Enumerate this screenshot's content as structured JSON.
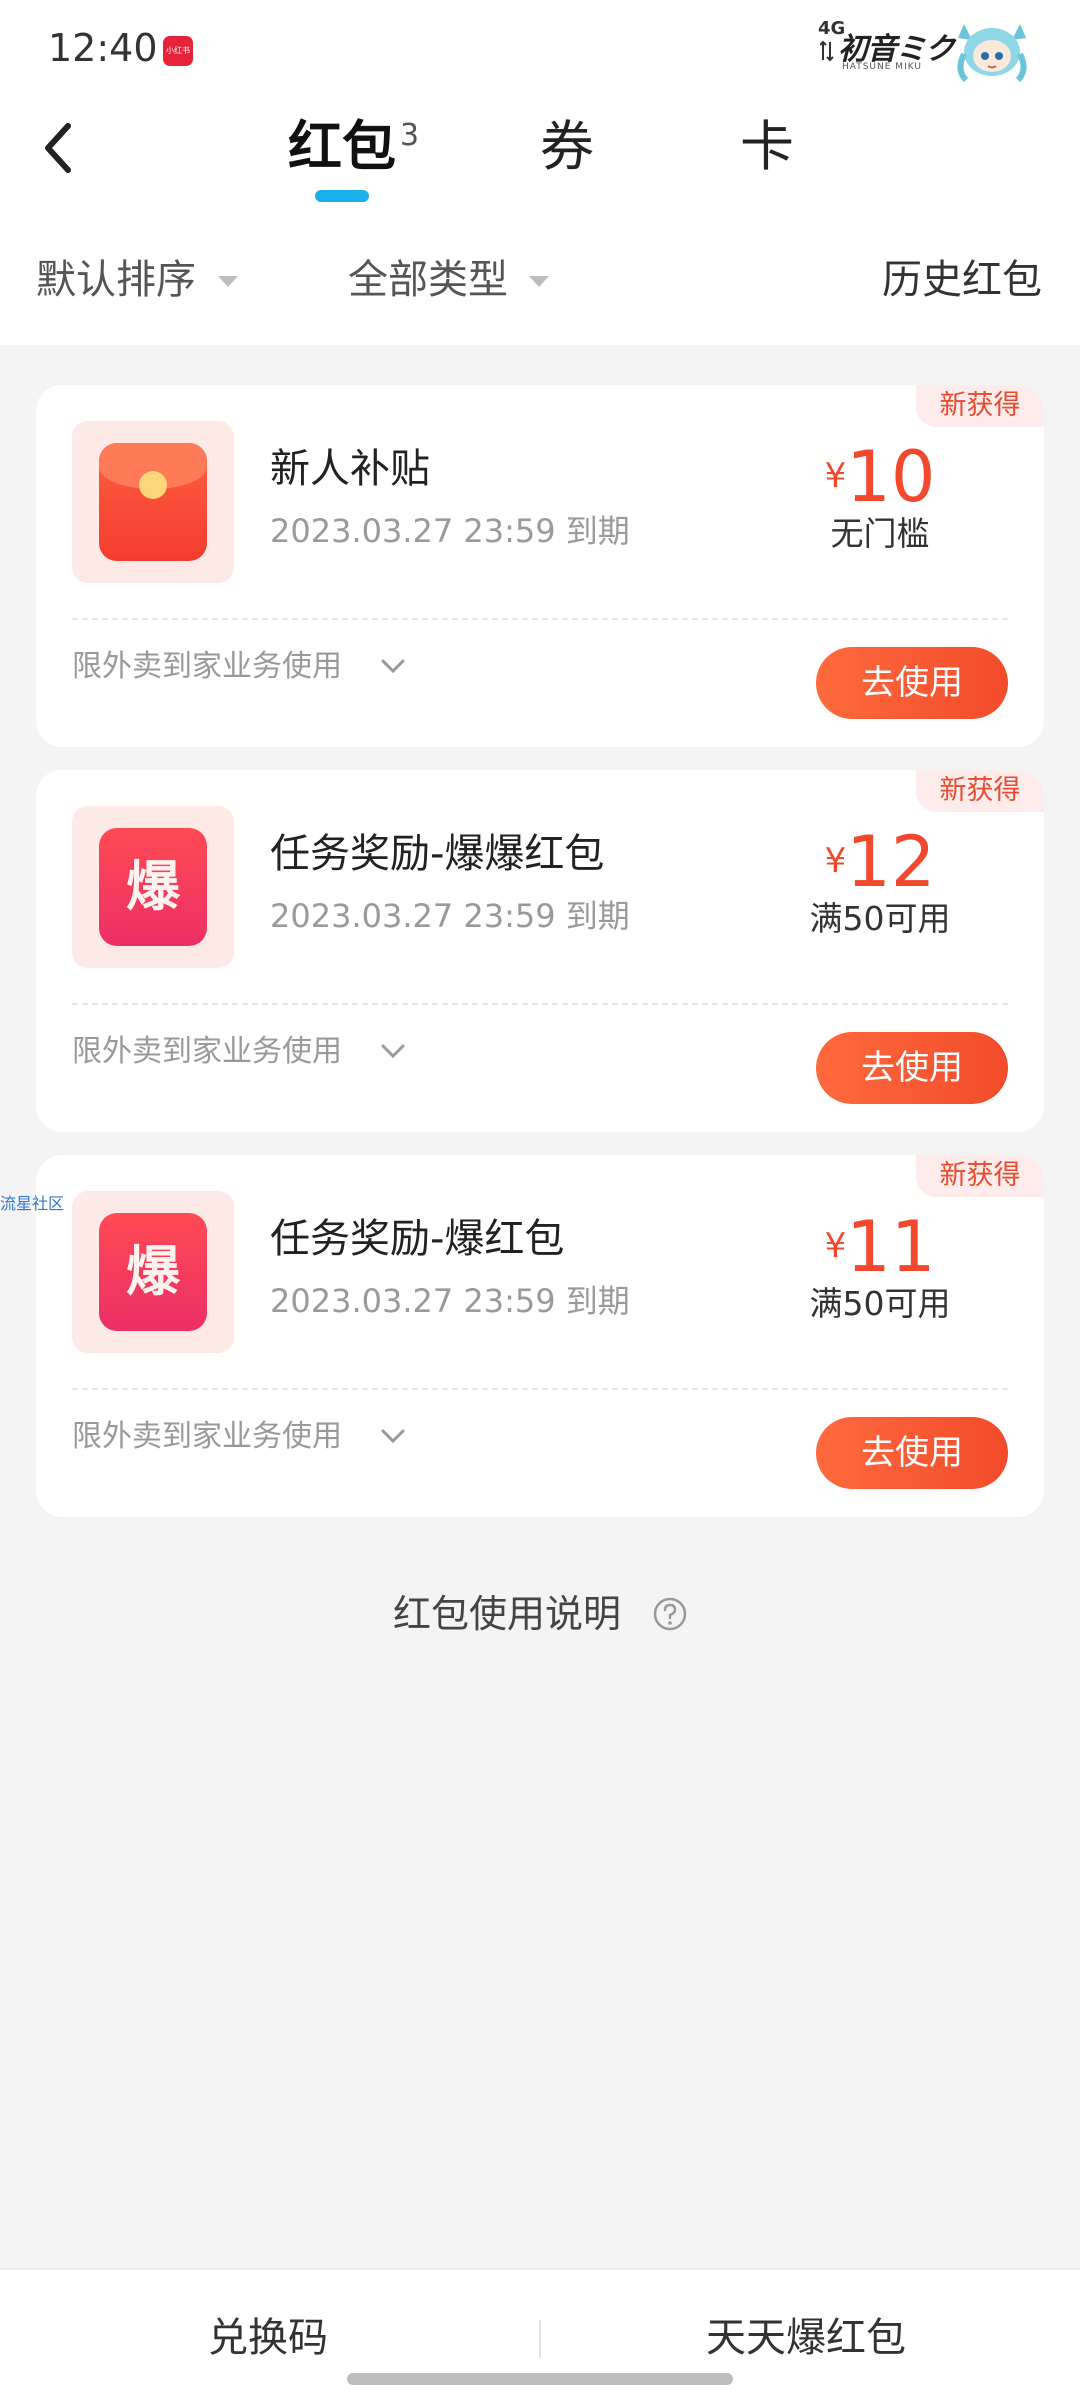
{
  "status_bar": {
    "time": "12:40",
    "app_badge": "小红书",
    "network": "4G",
    "brand": "初音ミク",
    "brand_sub": "HATSUNE MIKU",
    "icons": [
      "app-badge-icon",
      "signal-icon",
      "mascot-icon"
    ]
  },
  "nav": {
    "tabs": [
      {
        "label": "红包",
        "count": "3",
        "active": true
      },
      {
        "label": "券"
      },
      {
        "label": "卡"
      }
    ],
    "accent_color": "#19b0ec"
  },
  "filters": {
    "sort": "默认排序",
    "type": "全部类型",
    "history": "历史红包"
  },
  "cards": [
    {
      "badge": "新获得",
      "title": "新人补贴",
      "expiry": "2023.03.27 23:59 到期",
      "currency": "¥",
      "amount": "10",
      "condition": "无门槛",
      "scope": "限外卖到家业务使用",
      "button": "去使用",
      "icon": "red-envelope-icon"
    },
    {
      "badge": "新获得",
      "title": "任务奖励-爆爆红包",
      "expiry": "2023.03.27 23:59 到期",
      "currency": "¥",
      "amount": "12",
      "condition": "满50可用",
      "scope": "限外卖到家业务使用",
      "button": "去使用",
      "icon": "bao-icon",
      "icon_char": "爆"
    },
    {
      "badge": "新获得",
      "title": "任务奖励-爆红包",
      "expiry": "2023.03.27 23:59 到期",
      "currency": "¥",
      "amount": "11",
      "condition": "满50可用",
      "scope": "限外卖到家业务使用",
      "button": "去使用",
      "icon": "bao-icon",
      "icon_char": "爆"
    }
  ],
  "watermark": "流星社区",
  "help": {
    "label": "红包使用说明",
    "icon": "question-icon"
  },
  "bottom_bar": {
    "redeem": "兑换码",
    "daily": "天天爆红包"
  },
  "colors": {
    "price": "#f1482e",
    "button": "#f24b2b",
    "badge_bg": "#fdeceb",
    "page_bg": "#f4f4f4"
  }
}
